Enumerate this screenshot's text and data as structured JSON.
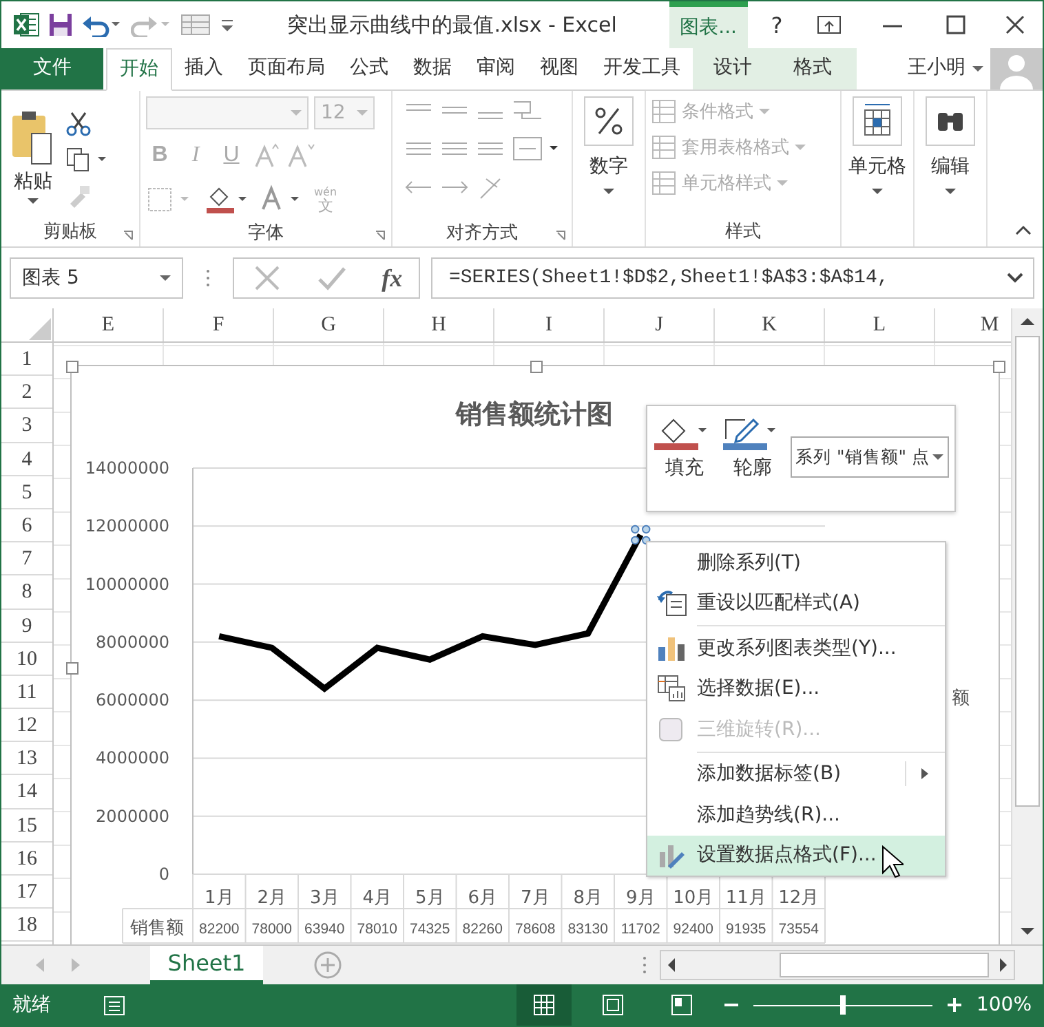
{
  "title_bar": {
    "title": "突出显示曲线中的最值.xlsx - Excel",
    "context_group": "图表...",
    "help": "?"
  },
  "ribbon_tabs": [
    {
      "label": "文件",
      "kind": "file",
      "selected": false
    },
    {
      "label": "开始",
      "kind": "tab",
      "selected": true
    },
    {
      "label": "插入",
      "kind": "tab",
      "selected": false
    },
    {
      "label": "页面布局",
      "kind": "tab",
      "selected": false
    },
    {
      "label": "公式",
      "kind": "tab",
      "selected": false
    },
    {
      "label": "数据",
      "kind": "tab",
      "selected": false
    },
    {
      "label": "审阅",
      "kind": "tab",
      "selected": false
    },
    {
      "label": "视图",
      "kind": "tab",
      "selected": false
    },
    {
      "label": "开发工具",
      "kind": "tab",
      "selected": false
    },
    {
      "label": "设计",
      "kind": "context",
      "selected": false
    },
    {
      "label": "格式",
      "kind": "context",
      "selected": false
    }
  ],
  "user": {
    "name": "王小明"
  },
  "ribbon_groups": [
    {
      "kind": "clipboard",
      "label": "剪贴板",
      "button": "粘贴"
    },
    {
      "kind": "font",
      "label": "字体",
      "disabled": true,
      "font_size": "12",
      "phonetic_top": "wén",
      "phonetic_bottom": "文",
      "bold": "B",
      "italic": "I",
      "underline": "U"
    },
    {
      "kind": "align",
      "label": "对齐方式",
      "disabled": true
    },
    {
      "kind": "number",
      "button": "数字"
    },
    {
      "kind": "styles",
      "label": "样式",
      "items": [
        {
          "label": "条件格式",
          "disabled": true
        },
        {
          "label": "套用表格格式",
          "disabled": true
        },
        {
          "label": "单元格样式",
          "disabled": true
        }
      ]
    },
    {
      "kind": "cells",
      "button": "单元格"
    },
    {
      "kind": "editing",
      "button": "编辑"
    }
  ],
  "formula_bar": {
    "name_box": "图表 5",
    "function_button": "fx",
    "formula": "=SERIES(Sheet1!$D$2,Sheet1!$A$3:$A$14,"
  },
  "columns": [
    "E",
    "F",
    "G",
    "H",
    "I",
    "J",
    "K",
    "L",
    "M"
  ],
  "rows": [
    "1",
    "2",
    "3",
    "4",
    "5",
    "6",
    "7",
    "8",
    "9",
    "10",
    "11",
    "12",
    "13",
    "14",
    "15",
    "16",
    "17",
    "18"
  ],
  "chart": {
    "legend_fragment": "额",
    "chart_data": {
      "type": "line",
      "title": "销售额统计图",
      "categories": [
        "1月",
        "2月",
        "3月",
        "4月",
        "5月",
        "6月",
        "7月",
        "8月",
        "9月",
        "10月",
        "11月",
        "12月"
      ],
      "series": [
        {
          "name": "销售额",
          "color": "#000000",
          "values": [
            8200000,
            7800000,
            6400000,
            7800000,
            7400000,
            8200000,
            7900000,
            8300000,
            11700000,
            null,
            null,
            null
          ]
        }
      ],
      "ylim": [
        0,
        14000000
      ],
      "yticks": [
        0,
        2000000,
        4000000,
        6000000,
        8000000,
        10000000,
        12000000,
        14000000
      ],
      "grid": true
    },
    "data_table": {
      "cells": [
        "82200",
        "78000",
        "63940",
        "78010",
        "74325",
        "82260",
        "78608",
        "83130",
        "11702",
        "92400",
        "91935",
        "73554"
      ]
    }
  },
  "mini_toolbar": {
    "fill_label": "填充",
    "outline_label": "轮廓",
    "element_select": "系列 \"销售额\" 点"
  },
  "context_menu": [
    {
      "kind": "item",
      "label": "删除系列(T)",
      "disabled": false,
      "selected": false,
      "submenu": false
    },
    {
      "kind": "item",
      "label": "重设以匹配样式(A)",
      "disabled": false,
      "selected": false,
      "submenu": false
    },
    {
      "kind": "separator"
    },
    {
      "kind": "item",
      "label": "更改系列图表类型(Y)...",
      "disabled": false,
      "selected": false,
      "submenu": false
    },
    {
      "kind": "item",
      "label": "选择数据(E)...",
      "disabled": false,
      "selected": false,
      "submenu": false
    },
    {
      "kind": "item",
      "label": "三维旋转(R)...",
      "disabled": true,
      "selected": false,
      "submenu": false
    },
    {
      "kind": "separator"
    },
    {
      "kind": "item",
      "label": "添加数据标签(B)",
      "disabled": false,
      "selected": false,
      "submenu": true
    },
    {
      "kind": "item",
      "label": "添加趋势线(R)...",
      "disabled": false,
      "selected": false,
      "submenu": false
    },
    {
      "kind": "item",
      "label": "设置数据点格式(F)...",
      "disabled": false,
      "selected": true,
      "submenu": false
    }
  ],
  "sheet_tabs": [
    {
      "label": "Sheet1",
      "selected": true
    }
  ],
  "status_bar": {
    "status": "就绪",
    "views": [
      {
        "kind": "normal",
        "selected": true
      },
      {
        "kind": "layout",
        "selected": false
      },
      {
        "kind": "pagebreak",
        "selected": false
      }
    ],
    "zoom": {
      "level": 0.5,
      "reading": "100%"
    }
  }
}
